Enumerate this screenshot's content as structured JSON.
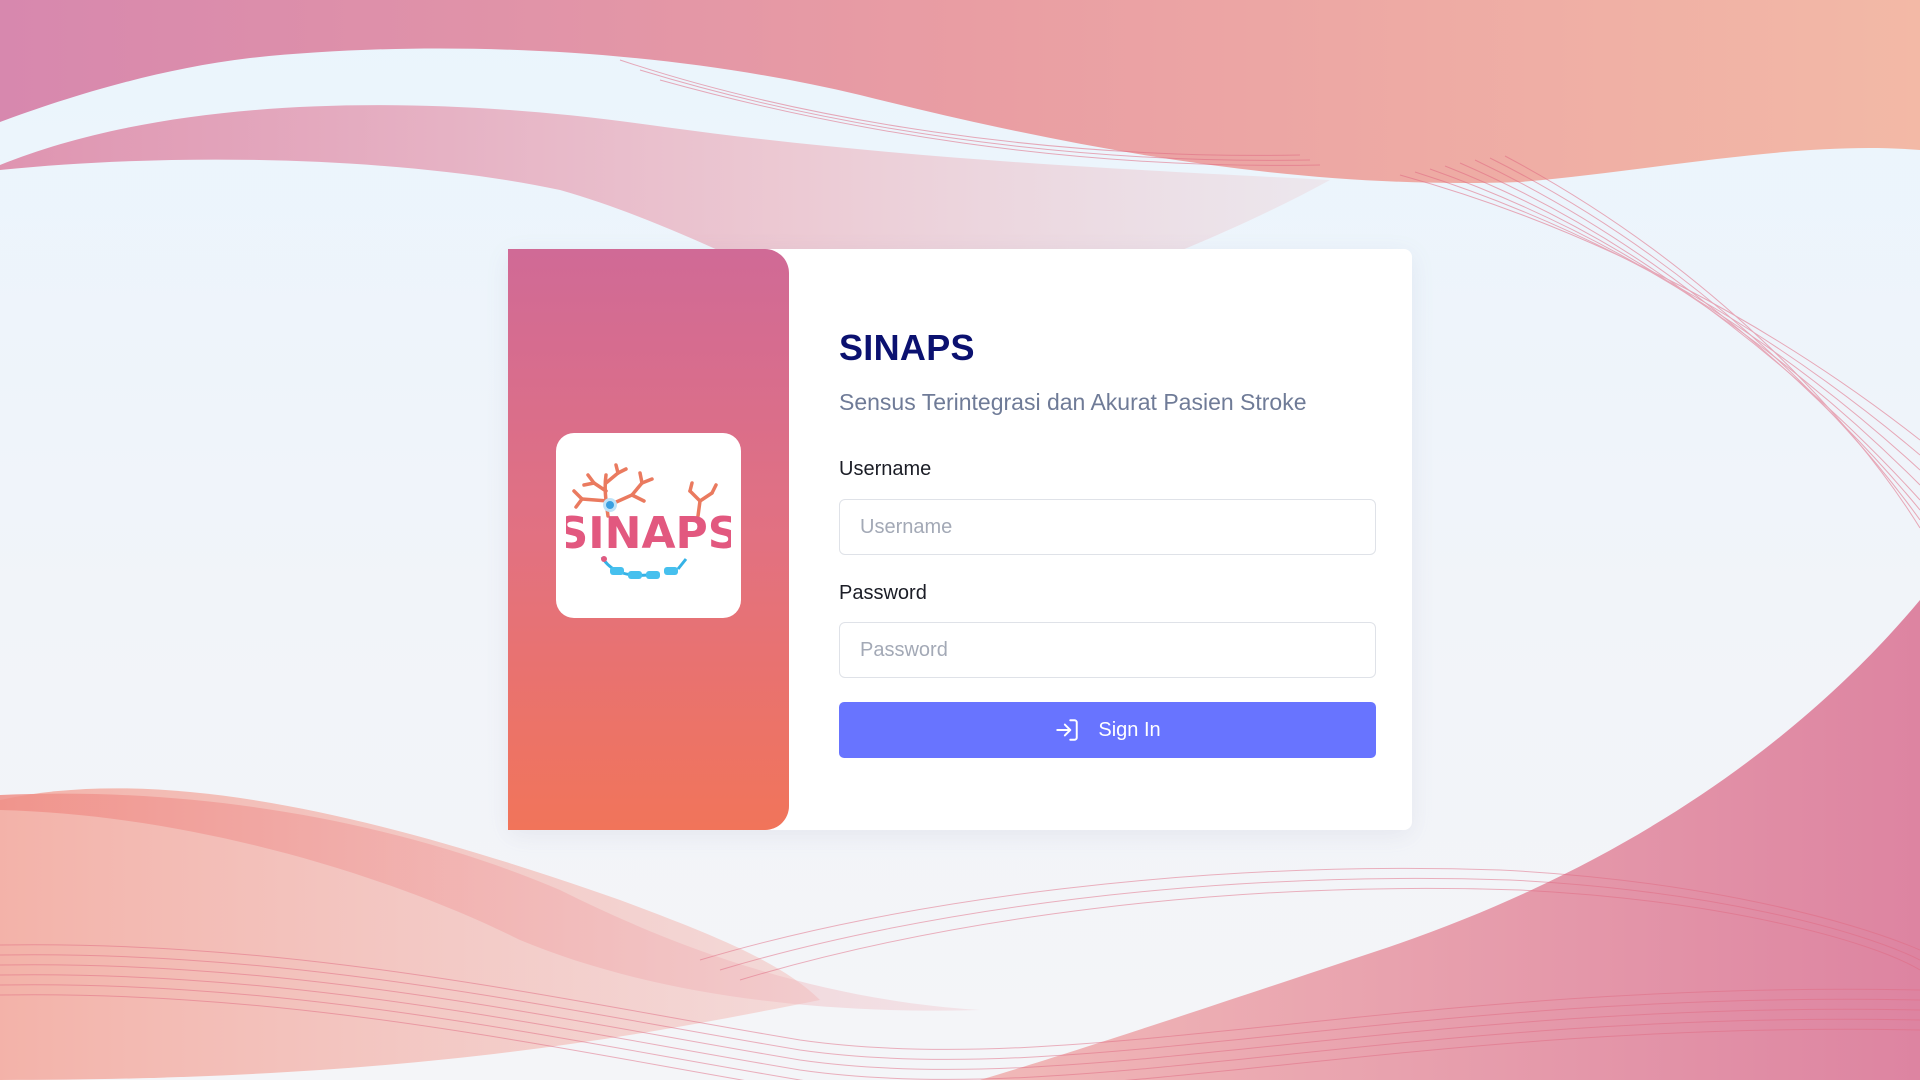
{
  "app": {
    "title": "SINAPS",
    "subtitle": "Sensus Terintegrasi dan Akurat Pasien Stroke",
    "logo_text": "SINAPS"
  },
  "form": {
    "username_label": "Username",
    "username_placeholder": "Username",
    "username_value": "",
    "password_label": "Password",
    "password_placeholder": "Password",
    "password_value": "",
    "submit_label": "Sign In",
    "submit_icon": "sign-in-icon"
  },
  "colors": {
    "title": "#0b1170",
    "button": "#6874ff",
    "panel_top": "#d06a96",
    "panel_bottom": "#f1745a"
  }
}
